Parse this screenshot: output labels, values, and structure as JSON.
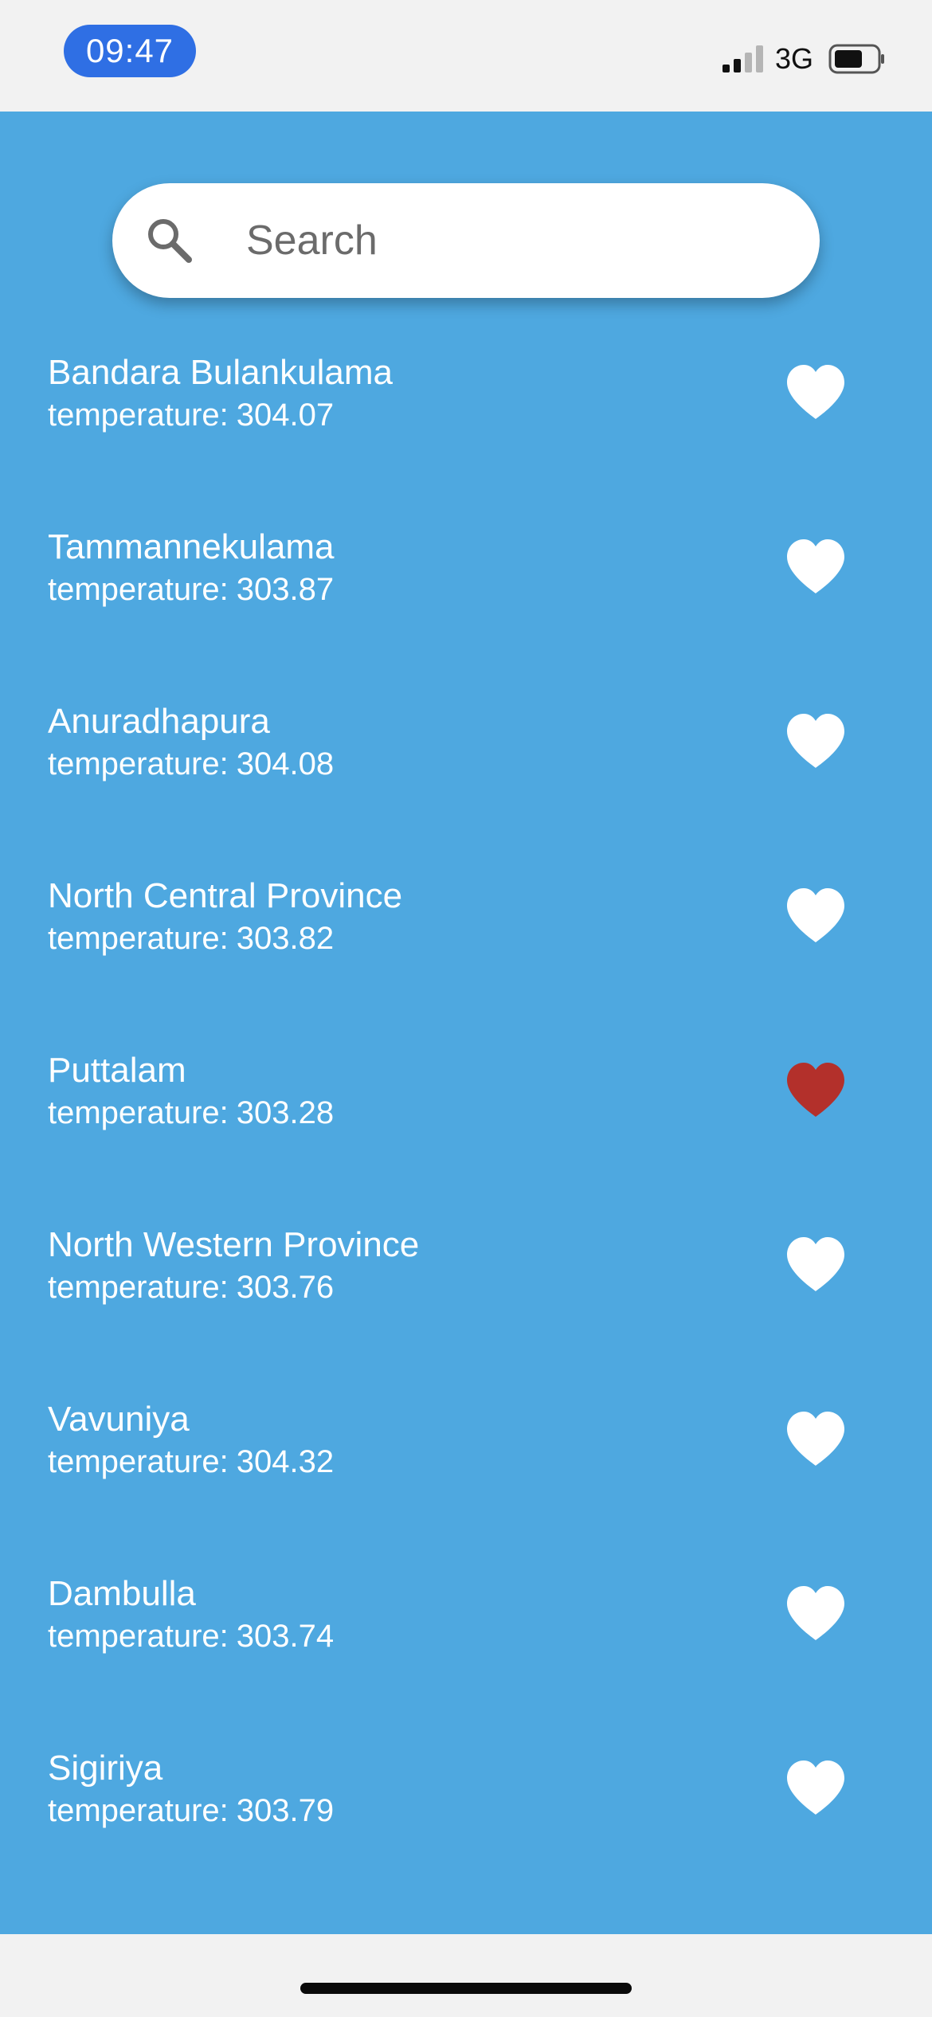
{
  "status_bar": {
    "time": "09:47",
    "network": "3G",
    "time_pill_color": "#2f6fe4"
  },
  "search": {
    "placeholder": "Search",
    "value": "",
    "icon": "search-icon"
  },
  "list": {
    "temperature_label": "temperature:",
    "heart_icon": "heart-icon",
    "favorite_color": "#b3302b",
    "default_color": "#ffffff",
    "items": [
      {
        "name": "Bandara Bulankulama",
        "temperature": "304.07",
        "favorite": false
      },
      {
        "name": "Tammannekulama",
        "temperature": "303.87",
        "favorite": false
      },
      {
        "name": "Anuradhapura",
        "temperature": "304.08",
        "favorite": false
      },
      {
        "name": "North Central Province",
        "temperature": "303.82",
        "favorite": false
      },
      {
        "name": "Puttalam",
        "temperature": "303.28",
        "favorite": true
      },
      {
        "name": "North Western Province",
        "temperature": "303.76",
        "favorite": false
      },
      {
        "name": "Vavuniya",
        "temperature": "304.32",
        "favorite": false
      },
      {
        "name": "Dambulla",
        "temperature": "303.74",
        "favorite": false
      },
      {
        "name": "Sigiriya",
        "temperature": "303.79",
        "favorite": false
      }
    ]
  },
  "theme": {
    "background_color": "#4ea8e0"
  }
}
